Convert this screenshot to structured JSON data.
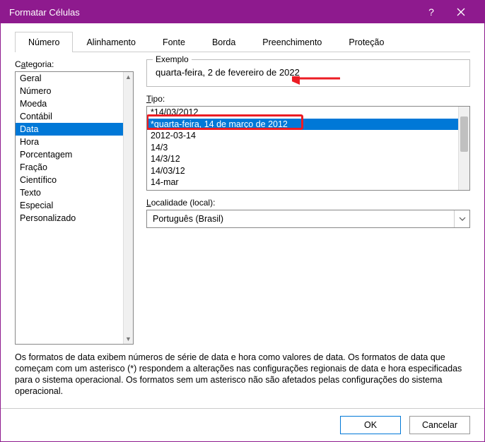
{
  "window": {
    "title": "Formatar Células"
  },
  "tabs": [
    "Número",
    "Alinhamento",
    "Fonte",
    "Borda",
    "Preenchimento",
    "Proteção"
  ],
  "active_tab": 0,
  "category": {
    "label_pre": "C",
    "label_u": "a",
    "label_post": "tegoria:",
    "items": [
      "Geral",
      "Número",
      "Moeda",
      "Contábil",
      "Data",
      "Hora",
      "Porcentagem",
      "Fração",
      "Científico",
      "Texto",
      "Especial",
      "Personalizado"
    ],
    "selected_index": 4
  },
  "example": {
    "legend": "Exemplo",
    "value": "quarta-feira, 2 de fevereiro de 2022"
  },
  "type": {
    "label_u": "T",
    "label_post": "ipo:",
    "items": [
      "*14/03/2012",
      "*quarta-feira, 14 de março de 2012",
      "2012-03-14",
      "14/3",
      "14/3/12",
      "14/03/12",
      "14-mar"
    ],
    "selected_index": 1
  },
  "locale": {
    "label_u": "L",
    "label_post": "ocalidade (local):",
    "value": "Português (Brasil)"
  },
  "description": "Os formatos de data exibem números de série de data e hora como valores de data. Os formatos de data que começam com um asterisco (*) respondem a alterações nas configurações regionais de data e hora especificadas para o sistema operacional. Os formatos sem um asterisco não são afetados pelas configurações do sistema operacional.",
  "buttons": {
    "ok": "OK",
    "cancel": "Cancelar"
  }
}
